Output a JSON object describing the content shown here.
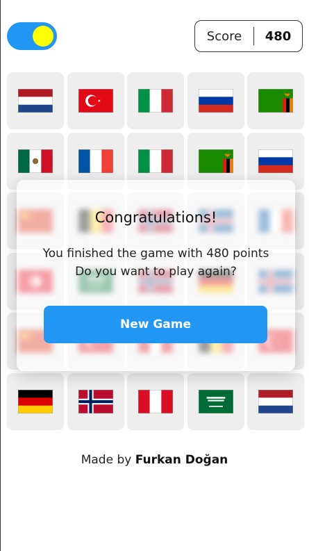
{
  "theme": {
    "accent": "#2196f3",
    "knob": "#ffff00",
    "card_bg": "#eeeeef"
  },
  "header": {
    "toggle_on": true,
    "score_label": "Score",
    "score_value": "480"
  },
  "grid": {
    "rows": [
      [
        "netherlands",
        "turkey",
        "italy",
        "russia",
        "zambia"
      ],
      [
        "mexico",
        "france",
        "italy",
        "zambia",
        "russia"
      ],
      [
        "china",
        "belgium",
        "norway",
        "iceland",
        "france"
      ],
      [
        "tunisia",
        "saudi-arabia",
        "norway",
        "germany",
        "iceland"
      ],
      [
        "china",
        "turkey",
        "peru",
        "belgium",
        "turkey"
      ],
      [
        "germany",
        "norway",
        "peru",
        "saudi-arabia",
        "netherlands"
      ]
    ],
    "blurred_rows": [
      2,
      3,
      4
    ]
  },
  "modal": {
    "title": "Congratulations!",
    "line1": "You finished the game with 480 points",
    "line2": "Do you want to play again?",
    "button": "New Game"
  },
  "footer": {
    "prefix": "Made by",
    "author": "Furkan Doğan"
  }
}
